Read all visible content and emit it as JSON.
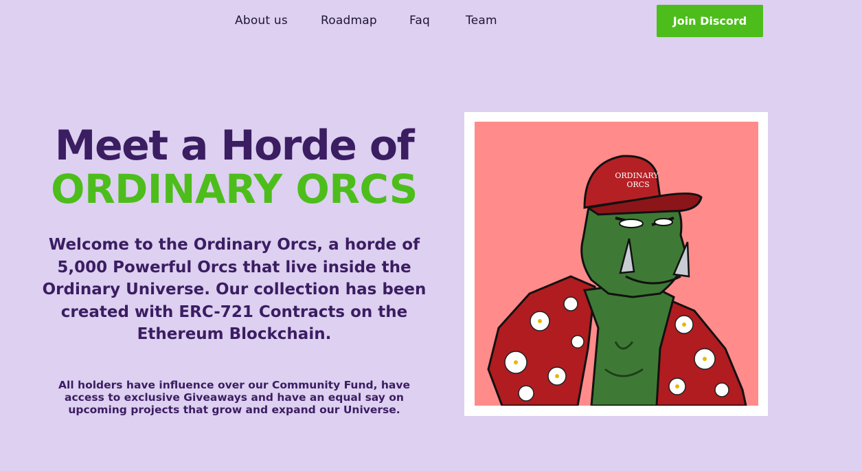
{
  "nav": {
    "links": [
      "About us",
      "Roadmap",
      "Faq",
      "Team"
    ],
    "cta": "Join Discord"
  },
  "hero": {
    "headline_line1": "Meet a Horde of",
    "headline_line2": "ORDINARY ORCS",
    "intro": "Welcome to the Ordinary Orcs, a horde of 5,000 Powerful Orcs that live inside the Ordinary Universe. Our collection has been created with ERC-721 Contracts on the Ethereum Blockchain.",
    "holders": "All holders have influence over our Community Fund, have access to exclusive Giveaways and have an equal say on upcoming projects that grow and expand our Universe."
  },
  "image": {
    "cap_text_line1": "ORDINARY",
    "cap_text_line2": "ORCS",
    "background_color": "#ff8b8b"
  },
  "colors": {
    "page_bg": "#ddd0f0",
    "primary_purple": "#3b1d62",
    "accent_green": "#4dbd1c",
    "orc_skin": "#3e7a35",
    "shirt_red": "#b01c20",
    "cap_red": "#b52025"
  }
}
